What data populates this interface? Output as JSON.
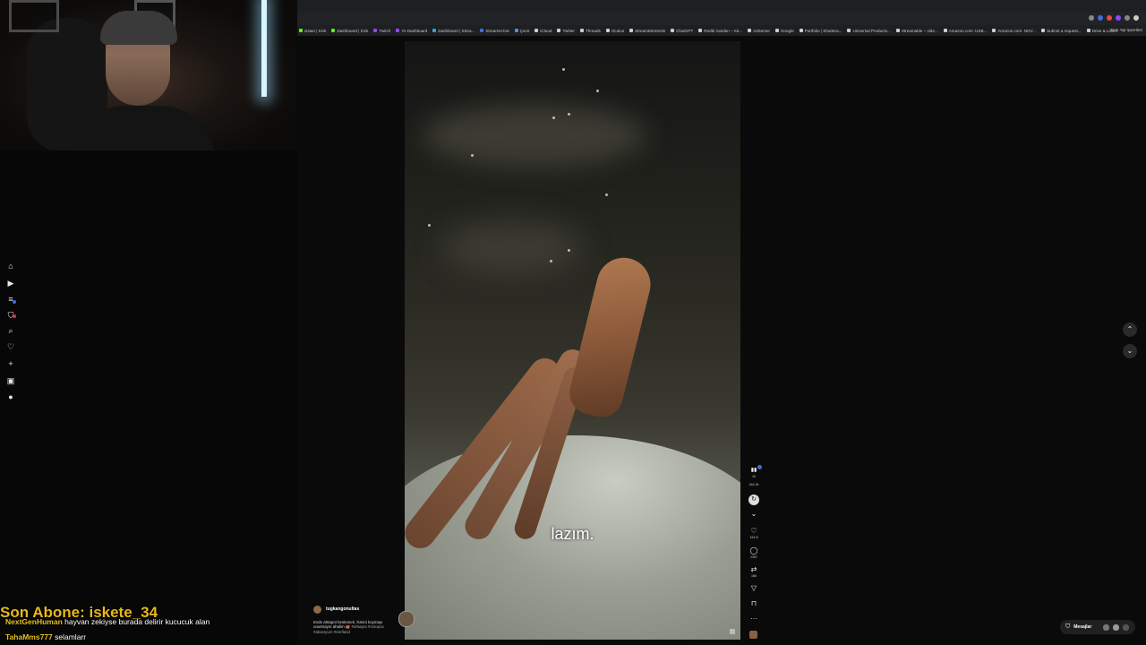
{
  "bookmarks": [
    {
      "label": "sistan | Kick",
      "color": "#53fc18"
    },
    {
      "label": "Dashboard | Kick",
      "color": "#53fc18"
    },
    {
      "label": "Twitch",
      "color": "#9146ff"
    },
    {
      "label": "Yo Dashboard",
      "color": "#9146ff"
    },
    {
      "label": "Dashboard | Strea...",
      "color": "#2ad"
    },
    {
      "label": "Streamer.bot",
      "color": "#3b6fe0"
    },
    {
      "label": "Çevir",
      "color": "#4a90e2"
    },
    {
      "label": "iCloud",
      "color": "#ccc"
    },
    {
      "label": "Twitter",
      "color": "#ccc"
    },
    {
      "label": "Threads",
      "color": "#ccc"
    },
    {
      "label": "Oculus",
      "color": "#ccc"
    },
    {
      "label": "StreamElements",
      "color": "#ccc"
    },
    {
      "label": "ChatGPT",
      "color": "#ccc"
    },
    {
      "label": "Redbi Garden – Kit...",
      "color": "#ccc"
    },
    {
      "label": "AdSense",
      "color": "#ccc"
    },
    {
      "label": "Google",
      "color": "#ccc"
    },
    {
      "label": "Portfolio | Shuttera...",
      "color": "#ccc"
    },
    {
      "label": "Universal Products...",
      "color": "#ccc"
    },
    {
      "label": "Streamable – vide...",
      "color": "#ccc"
    },
    {
      "label": "Amazon.com: USB...",
      "color": "#ccc"
    },
    {
      "label": "Amazon.com: NOV...",
      "color": "#ccc"
    },
    {
      "label": "Submit a request...",
      "color": "#ccc"
    },
    {
      "label": "Drive & Listen",
      "color": "#ccc"
    }
  ],
  "bookmarks_more": "»",
  "bookmarks_all": "Tüm Yer işaretleri",
  "sidebar": {
    "items": [
      {
        "name": "home-icon",
        "glyph": "⌂"
      },
      {
        "name": "explore-icon",
        "glyph": "▶"
      },
      {
        "name": "following-icon",
        "glyph": "≡"
      },
      {
        "name": "friends-icon",
        "glyph": "⛉"
      },
      {
        "name": "search-icon",
        "glyph": "⌕"
      },
      {
        "name": "activity-icon",
        "glyph": "♡"
      },
      {
        "name": "upload-icon",
        "glyph": "+"
      },
      {
        "name": "messages-icon",
        "glyph": "▣"
      },
      {
        "name": "profile-icon",
        "glyph": "●"
      }
    ]
  },
  "video": {
    "subtitle": "lazım."
  },
  "caption": {
    "username": "tugkangonultas",
    "text": "Evde ahtapot beslemek. İsmini koymayı unutmayın ahalim 🐙",
    "tags": "#ahtapot #octopus #akvaryum #reefland"
  },
  "actions": {
    "top_count": "10",
    "top_label": "444.2k",
    "like_count": "161.8",
    "comment_count": "1397",
    "share_count": "166"
  },
  "messages": {
    "label": "Mesajlar"
  },
  "stream": {
    "latest_sub_label": "Son Abone: iskete_34",
    "chat": [
      {
        "name": "NextGenHuman",
        "message": "hayvan zekiyse burada delirir kucucuk alan",
        "color": "#e8c020"
      },
      {
        "name": "TahaMms777",
        "message": "selamlarr",
        "color": "#e8c020"
      }
    ]
  }
}
